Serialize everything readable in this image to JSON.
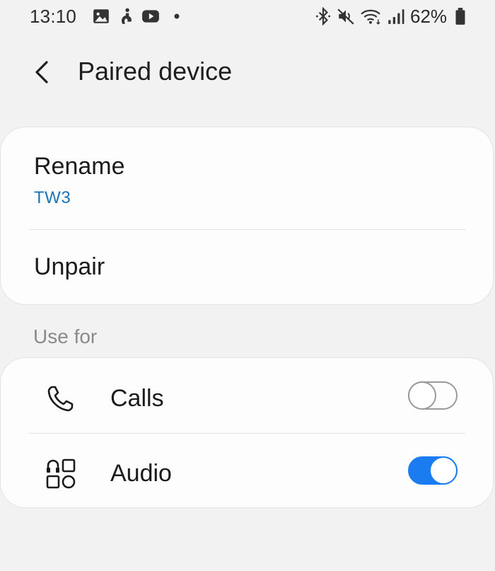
{
  "status_bar": {
    "time": "13:10",
    "battery": "62%",
    "left_icons": [
      "gallery-icon",
      "accessibility-icon",
      "youtube-icon",
      "notification-dot-icon"
    ],
    "right_icons": [
      "bluetooth-icon",
      "mute-icon",
      "wifi-icon",
      "signal-icon",
      "battery-icon"
    ]
  },
  "header": {
    "back_icon": "back-arrow-icon",
    "title": "Paired device"
  },
  "device_card": {
    "rename_label": "Rename",
    "device_name": "TW3",
    "unpair_label": "Unpair"
  },
  "use_for": {
    "section_label": "Use for",
    "items": [
      {
        "label": "Calls",
        "icon": "phone-icon",
        "enabled": false
      },
      {
        "label": "Audio",
        "icon": "audio-apps-icon",
        "enabled": true
      }
    ]
  },
  "colors": {
    "accent": "#1a7cf0",
    "link": "#1a73b5",
    "background": "#f2f2f2",
    "card": "#fdfdfd",
    "section_label": "#8a8a8a"
  }
}
